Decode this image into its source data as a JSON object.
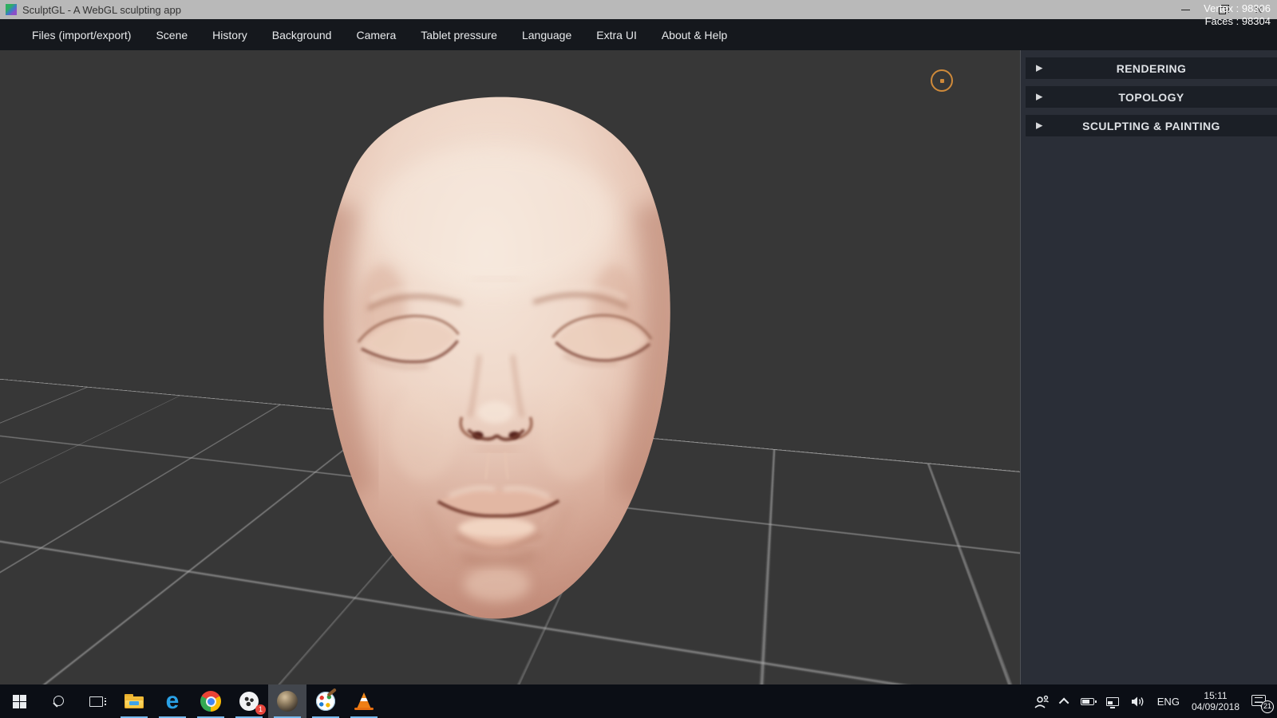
{
  "window": {
    "title": "SculptGL - A WebGL sculpting app",
    "stats": {
      "vertex": "Vertex : 98306",
      "faces": "Faces : 98304"
    }
  },
  "icons": {
    "collapse_arrow": "▶",
    "close_glyph": "✕",
    "edge_glyph": "e"
  },
  "menubar": {
    "items": [
      "Files (import/export)",
      "Scene",
      "History",
      "Background",
      "Camera",
      "Tablet pressure",
      "Language",
      "Extra UI",
      "About & Help"
    ]
  },
  "sidebar": {
    "panels": [
      {
        "label": "RENDERING"
      },
      {
        "label": "TOPOLOGY"
      },
      {
        "label": "SCULPTING & PAINTING"
      }
    ]
  },
  "viewport": {
    "background_color": "#373737",
    "grid_color": "#afafaf",
    "brush_cursor_color": "#cf8a3a",
    "skin_highlight_color": "#f5e6da",
    "skin_shadow_color": "#bd8374"
  },
  "taskbar": {
    "badge_app_count": "1",
    "running_underline_color": "#76b9ed",
    "tray": {
      "language": "ENG",
      "time": "15:11",
      "date": "04/09/2018",
      "notifications": "21"
    }
  }
}
